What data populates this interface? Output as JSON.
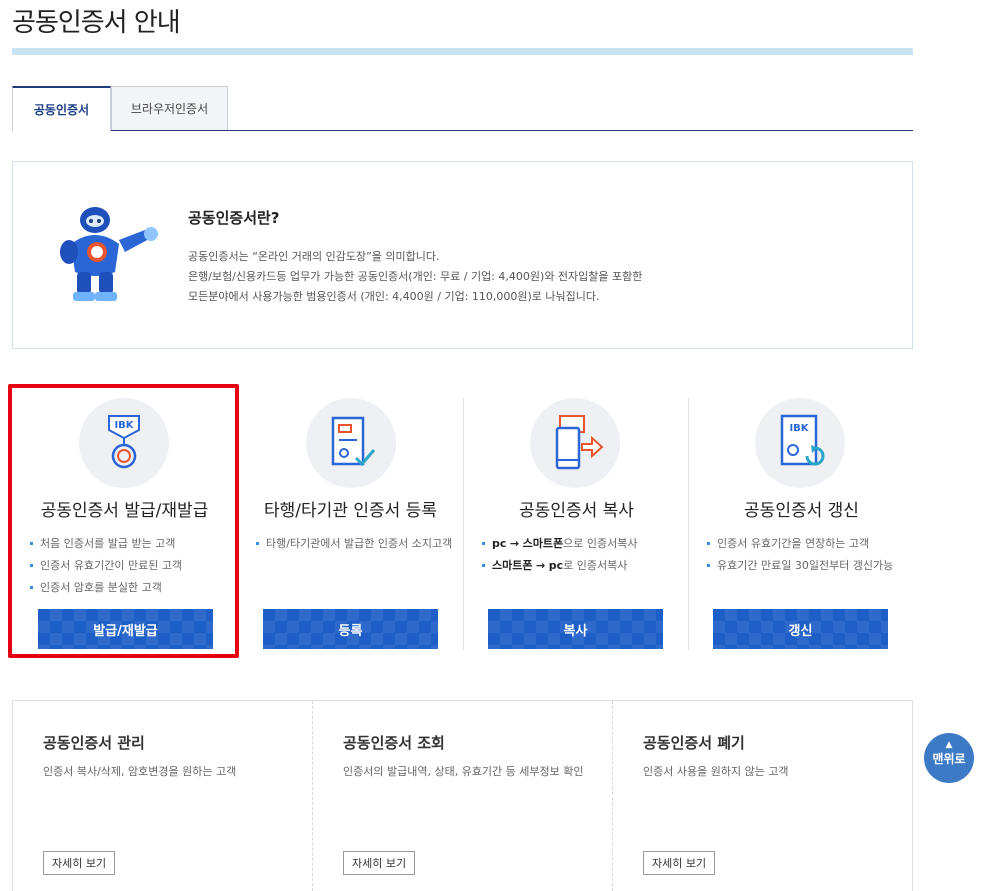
{
  "page": {
    "title": "공동인증서 안내"
  },
  "tabs": [
    {
      "label": "공동인증서",
      "active": true
    },
    {
      "label": "브라우저인증서",
      "active": false
    }
  ],
  "intro": {
    "title": "공동인증서란?",
    "lines": [
      "공동인증서는 “온라인 거래의 인감도장”을 의미합니다.",
      "은행/보험/신용카드등 업무가 가능한 공동인증서(개인: 무료 / 기업: 4,400원)와 전자입찰을 포함한",
      "모든분야에서 사용가능한 범용인증서 (개인: 4,400원 / 기업: 110,000원)로 나눠집니다."
    ]
  },
  "cards": [
    {
      "title": "공동인증서 발급/재발급",
      "icon": "medal-icon",
      "items": [
        "처음 인증서를 발급 받는 고객",
        "인증서 유효기간이 만료된 고객",
        "인증서 암호를 분실한 고객"
      ],
      "button": "발급/재발급"
    },
    {
      "title": "타행/타기관 인증서 등록",
      "icon": "certificate-check-icon",
      "items": [
        "타행/타기관에서 발급한 인증서 소지고객"
      ],
      "button": "등록"
    },
    {
      "title": "공동인증서 복사",
      "icon": "copy-to-phone-icon",
      "items_rich": [
        {
          "a": "pc",
          "arrow": "→",
          "b": "스마트폰",
          "rest": "으로 인증서복사"
        },
        {
          "a": "스마트폰",
          "arrow": "→",
          "b": "pc",
          "rest": "로 인증서복사"
        }
      ],
      "button": "복사"
    },
    {
      "title": "공동인증서 갱신",
      "icon": "renew-icon",
      "items": [
        "인증서 유효기간을 연장하는 고객",
        "유효기간 만료일 30일전부터 갱신가능"
      ],
      "button": "갱신"
    }
  ],
  "icon_text": {
    "ibk": "IBK"
  },
  "bottom": [
    {
      "title": "공동인증서 관리",
      "desc": "인증서 복사/삭제, 암호변경을 원하는 고객",
      "button": "자세히 보기"
    },
    {
      "title": "공동인증서 조회",
      "desc": "인증서의 발급내역, 상태, 유효기간 등 세부정보 확인",
      "button": "자세히 보기"
    },
    {
      "title": "공동인증서 폐기",
      "desc": "인증서 사용을 원하지 않는 고객",
      "button": "자세히 보기"
    }
  ],
  "top_button": {
    "arrow": "▲",
    "label": "맨위로"
  },
  "colors": {
    "primary": "#1e5fc7",
    "navy": "#1f3b7a",
    "highlight": "#e60012"
  }
}
